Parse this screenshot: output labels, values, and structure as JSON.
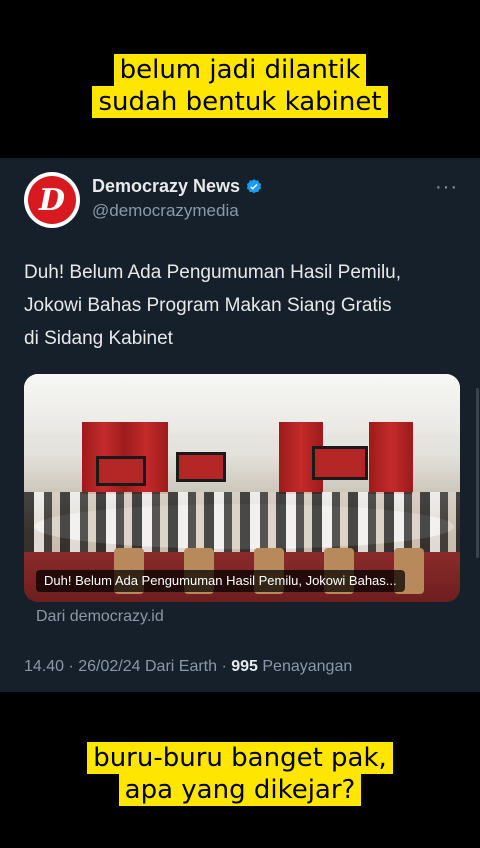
{
  "captions": {
    "top": [
      "belum jadi dilantik",
      "sudah bentuk kabinet"
    ],
    "bottom": [
      "buru-buru banget pak,",
      "apa yang dikejar?"
    ]
  },
  "tweet": {
    "author": {
      "name": "Democrazy News",
      "handle": "@democrazymedia",
      "avatar_letter": "D",
      "verified": true
    },
    "more_label": "···",
    "text_lines": [
      "Duh! Belum Ada Pengumuman Hasil Pemilu,",
      "Jokowi Bahas Program Makan Siang Gratis",
      "di Sidang Kabinet"
    ],
    "media": {
      "icon": "news-photo-image",
      "overlay_title": "Duh! Belum Ada Pengumuman Hasil Pemilu, Jokowi Bahas..."
    },
    "source_label": "Dari democrazy.id",
    "meta": {
      "time_date": "14.40 · 26/02/24 Dari Earth · ",
      "views_count": "995",
      "views_label": " Penayangan"
    }
  },
  "colors": {
    "caption_bg": "#ffe600",
    "card_bg": "#15202b",
    "verified": "#1d9bf0",
    "brand_red": "#d71920"
  }
}
